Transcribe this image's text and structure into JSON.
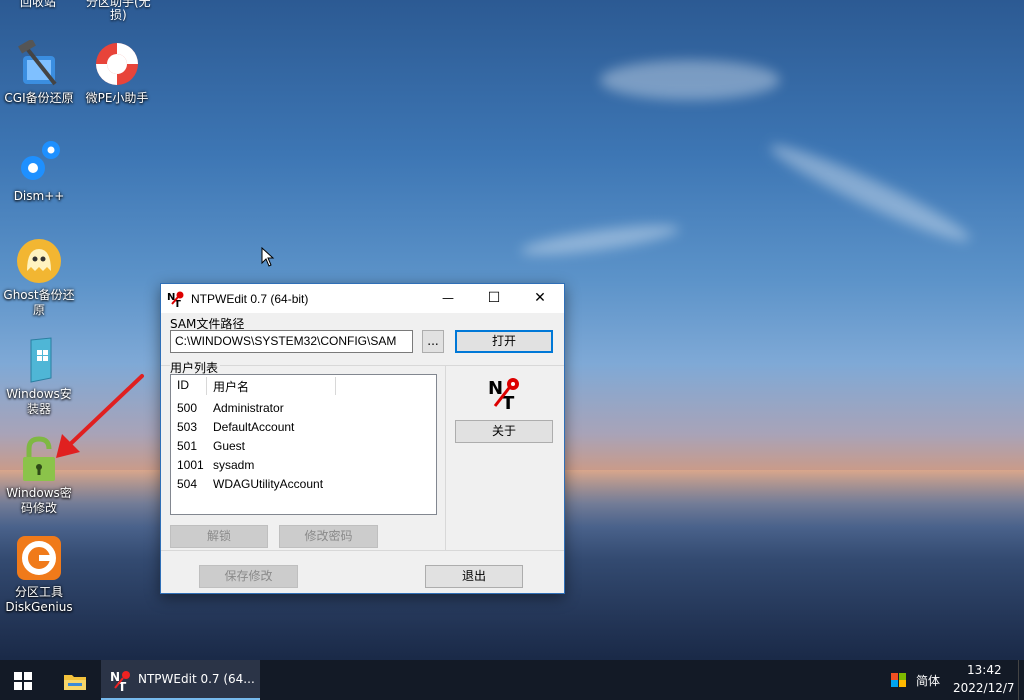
{
  "desktop": {
    "top_partial_labels": [
      "回收站",
      "分区助手(无",
      "损)"
    ],
    "icons": [
      {
        "name": "cgi-backup-icon",
        "label": "CGI备份还原"
      },
      {
        "name": "weipe-helper-icon",
        "label": "微PE小助手"
      },
      {
        "name": "dism-icon",
        "label": "Dism++"
      },
      {
        "name": "ghost-icon",
        "label": "Ghost备份还原"
      },
      {
        "name": "windows-installer-icon",
        "label": "Windows安装器"
      },
      {
        "name": "windows-password-icon",
        "label": "Windows密码修改"
      },
      {
        "name": "diskgenius-icon",
        "label": "分区工具DiskGenius"
      }
    ]
  },
  "window": {
    "title": "NTPWEdit 0.7 (64-bit)",
    "minimize": "—",
    "maximize": "☐",
    "close": "✕",
    "sam_label": "SAM文件路径",
    "sam_path": "C:\\WINDOWS\\SYSTEM32\\CONFIG\\SAM",
    "browse_label": "...",
    "open_label": "打开",
    "user_list_label": "用户列表",
    "columns": [
      "ID",
      "用户名"
    ],
    "users": [
      {
        "id": "500",
        "name": "Administrator"
      },
      {
        "id": "503",
        "name": "DefaultAccount"
      },
      {
        "id": "501",
        "name": "Guest"
      },
      {
        "id": "1001",
        "name": "sysadm"
      },
      {
        "id": "504",
        "name": "WDAGUtilityAccount"
      }
    ],
    "about_label": "关于",
    "unlock_label": "解锁",
    "change_password_label": "修改密码",
    "save_label": "保存修改",
    "exit_label": "退出"
  },
  "taskbar": {
    "app_label": "NTPWEdit 0.7 (64...",
    "ime_label": "简体",
    "time": "13:42",
    "date": "2022/12/7"
  },
  "colors": {
    "accent": "#0078d7",
    "taskbar": "#131a26",
    "arrow": "#e02020"
  }
}
